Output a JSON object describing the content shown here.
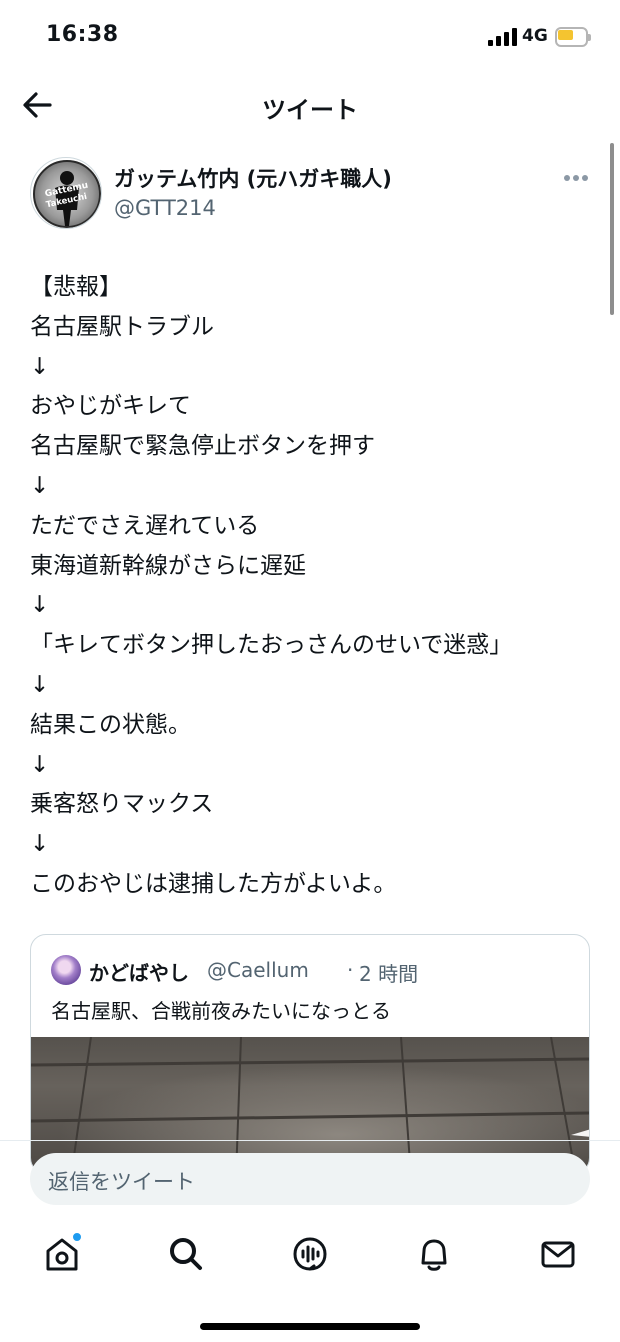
{
  "status_bar": {
    "time": "16:38",
    "network": "4G",
    "battery_level": 0.55,
    "battery_color": "#f4c430"
  },
  "header": {
    "title": "ツイート",
    "back_icon": "arrow-left-icon"
  },
  "author": {
    "display_name": "ガッテム竹内 (元ハガキ職人)",
    "handle": "@GTT214",
    "avatar_text": "Gattemu Takeuchi",
    "more_icon": "more-horizontal-icon"
  },
  "tweet": {
    "lines": [
      "【悲報】",
      "名古屋駅トラブル",
      "↓",
      "おやじがキレて",
      "名古屋駅で緊急停止ボタンを押す",
      "↓",
      "ただでさえ遅れている",
      "東海道新幹線がさらに遅延",
      "↓",
      "「キレてボタン押したおっさんのせいで迷惑」",
      "↓",
      "結果この状態。",
      "↓",
      "乗客怒りマックス",
      "↓",
      "このおやじは逮捕した方がよいよ。"
    ]
  },
  "quote": {
    "display_name": "かどばやし",
    "handle": "@Caellum",
    "separator": "·",
    "time": "2 時間",
    "text": "名古屋駅、合戦前夜みたいになっとる"
  },
  "reply": {
    "placeholder": "返信をツイート"
  },
  "nav": {
    "items": [
      "home-icon",
      "search-icon",
      "spaces-icon",
      "notifications-icon",
      "messages-icon"
    ],
    "accent_color": "#1d9bf0"
  }
}
